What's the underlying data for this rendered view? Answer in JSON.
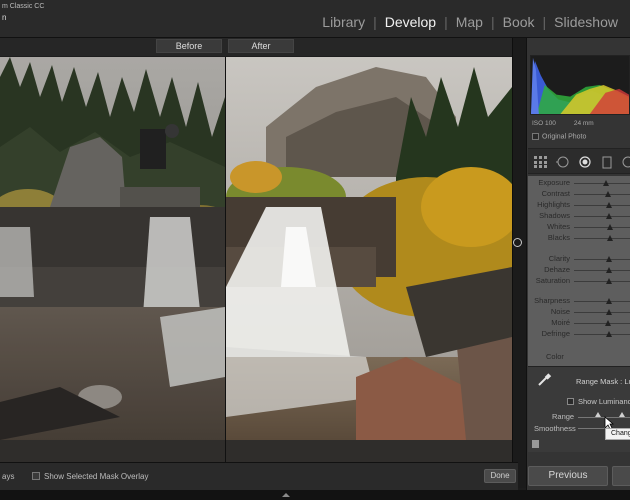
{
  "app": {
    "name_fragment": "m Classic CC",
    "catalog_fragment": "n"
  },
  "modules": {
    "items": [
      "Library",
      "Develop",
      "Map",
      "Book",
      "Slideshow"
    ],
    "active": "Develop"
  },
  "compare": {
    "before_label": "Before",
    "after_label": "After"
  },
  "toolbar": {
    "left_fragment": "ays",
    "mask_overlay_label": "Show Selected Mask Overlay",
    "done_label": "Done"
  },
  "histogram_info": {
    "iso": "ISO 100",
    "focal_length": "24 mm",
    "original_photo_label": "Original Photo"
  },
  "adjustments": {
    "sliders": [
      {
        "label": "Exposure",
        "value": 0.58
      },
      {
        "label": "Contrast",
        "value": 0.6
      },
      {
        "label": "Highlights",
        "value": 0.62
      },
      {
        "label": "Shadows",
        "value": 0.62
      },
      {
        "label": "Whites",
        "value": 0.64
      },
      {
        "label": "Blacks",
        "value": 0.65
      },
      {
        "label": "Clarity",
        "value": 0.62
      },
      {
        "label": "Dehaze",
        "value": 0.62
      },
      {
        "label": "Saturation",
        "value": 0.63
      },
      {
        "label": "Sharpness",
        "value": 0.62
      },
      {
        "label": "Noise",
        "value": 0.62
      },
      {
        "label": "Moiré",
        "value": 0.6
      },
      {
        "label": "Defringe",
        "value": 0.62
      }
    ],
    "color_label": "Color"
  },
  "range_mask": {
    "label": "Range Mask : Lum",
    "show_luminance_label": "Show Luminance",
    "range_label": "Range",
    "smoothness_label": "Smoothness",
    "tooltip": "Chang",
    "range_low": 0.38,
    "range_high": 0.85,
    "smoothness": 0.55
  },
  "buttons": {
    "previous_label": "Previous"
  },
  "colors": {
    "panel_bg": "#343434",
    "slider_bg": "#5e5e5e",
    "active_module": "#f2f2f2"
  }
}
